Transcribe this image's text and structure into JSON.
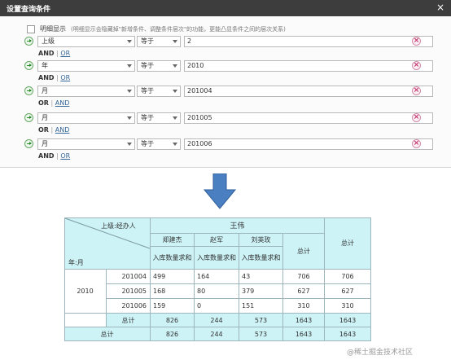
{
  "dialog": {
    "title": "设置查询条件",
    "close_label": "×",
    "detail": {
      "label": "明细显示",
      "note": "(明细显示会隐藏掉\"新增条件、调整条件层次\"的功能，更能凸显条件之间的层次关系)"
    },
    "conditions": [
      {
        "field": "上级",
        "operator": "等于",
        "value": "2",
        "logic_main": "AND",
        "logic_sep": " | ",
        "logic_alt": "OR"
      },
      {
        "field": "年",
        "operator": "等于",
        "value": "2010",
        "logic_main": "AND",
        "logic_sep": " | ",
        "logic_alt": "OR"
      },
      {
        "field": "月",
        "operator": "等于",
        "value": "201004",
        "logic_main": "OR",
        "logic_sep": " | ",
        "logic_alt": "AND"
      },
      {
        "field": "月",
        "operator": "等于",
        "value": "201005",
        "logic_main": "OR",
        "logic_sep": " | ",
        "logic_alt": "AND"
      },
      {
        "field": "月",
        "operator": "等于",
        "value": "201006",
        "logic_main": "AND",
        "logic_sep": " | ",
        "logic_alt": "OR"
      }
    ]
  },
  "arrow": {
    "color": "#4a7fc1"
  },
  "pivot": {
    "corner_top": "上级:经办人",
    "corner_bottom": "年:月",
    "group": "王伟",
    "people": [
      "郑建杰",
      "赵军",
      "刘英玫"
    ],
    "measure": "入库数量求和",
    "subtotal": "总计",
    "grand_total": "总计",
    "year": "2010",
    "months": [
      "201004",
      "201005",
      "201006"
    ],
    "rows": [
      [
        "499",
        "164",
        "43",
        "706",
        "706"
      ],
      [
        "168",
        "80",
        "379",
        "627",
        "627"
      ],
      [
        "159",
        "0",
        "151",
        "310",
        "310"
      ]
    ],
    "year_total_label": "总计",
    "year_total": [
      "826",
      "244",
      "573",
      "1643",
      "1643"
    ],
    "grand_total_label": "总计",
    "grand_total_row": [
      "826",
      "244",
      "573",
      "1643",
      "1643"
    ]
  },
  "watermark": "@稀土掘金技术社区"
}
